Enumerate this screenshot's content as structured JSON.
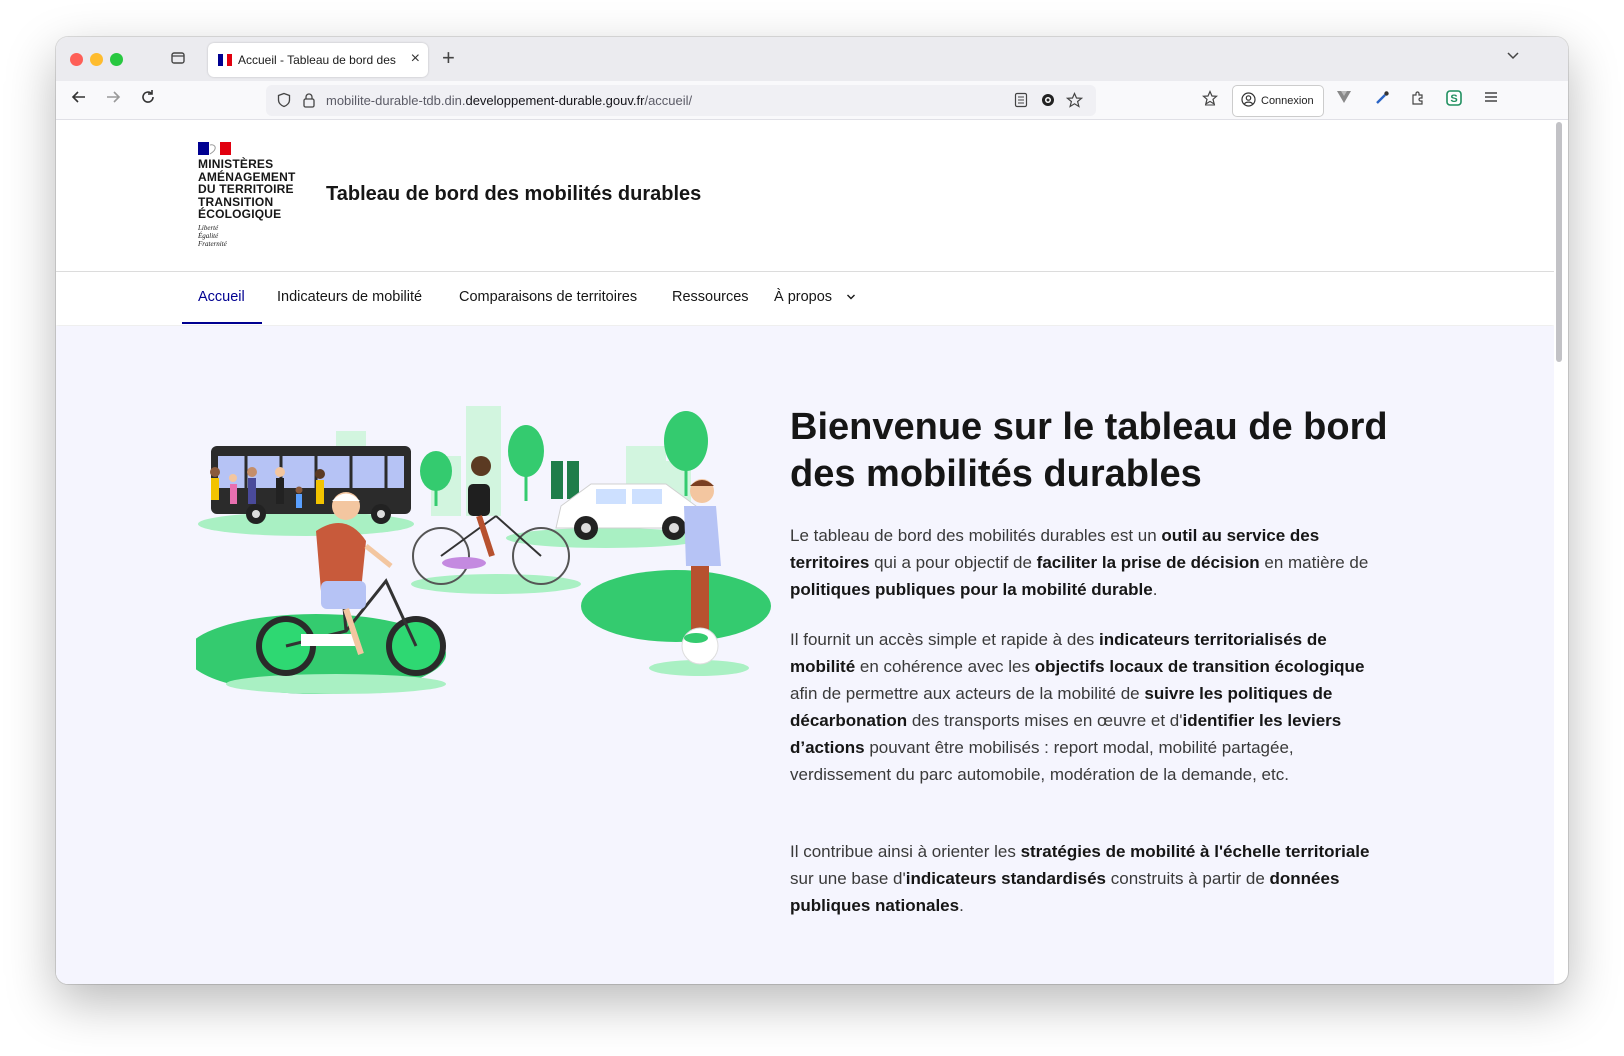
{
  "browser": {
    "tab_title": "Accueil - Tableau de bord des m",
    "url_prefix": "mobilite-durable-tdb.din.",
    "url_domain": "developpement-durable.gouv.fr",
    "url_path": "/accueil/",
    "login_label": "Connexion"
  },
  "header": {
    "ministry_lines": [
      "MINISTÈRES",
      "AMÉNAGEMENT",
      "DU TERRITOIRE",
      "TRANSITION",
      "ÉCOLOGIQUE"
    ],
    "motto_lines": [
      "Liberté",
      "Égalité",
      "Fraternité"
    ],
    "site_title": "Tableau de bord des mobilités durables"
  },
  "nav": {
    "items": [
      "Accueil",
      "Indicateurs de mobilité",
      "Comparaisons de territoires",
      "Ressources",
      "À propos"
    ],
    "active": "Accueil"
  },
  "hero": {
    "title": "Bienvenue sur le tableau de bord des mobilités durables",
    "p1": [
      {
        "t": "Le tableau de bord des mobilités durables est un ",
        "b": false
      },
      {
        "t": "outil au service des territoires",
        "b": true
      },
      {
        "t": " qui a pour objectif de ",
        "b": false
      },
      {
        "t": "faciliter la prise de décision",
        "b": true
      },
      {
        "t": " en matière de ",
        "b": false
      },
      {
        "t": "politiques publiques pour la mobilité durable",
        "b": true
      },
      {
        "t": ".",
        "b": false
      }
    ],
    "p2": [
      {
        "t": "Il fournit un accès simple et rapide à des ",
        "b": false
      },
      {
        "t": "indicateurs territorialisés de mobilité",
        "b": true
      },
      {
        "t": " en cohérence avec les ",
        "b": false
      },
      {
        "t": "objectifs locaux de transition écologique",
        "b": true
      },
      {
        "t": " afin de permettre aux acteurs de la mobilité de ",
        "b": false
      },
      {
        "t": "suivre les politiques de décarbonation",
        "b": true
      },
      {
        "t": " des transports mises en œuvre et d'",
        "b": false
      },
      {
        "t": "identifier les leviers d’actions",
        "b": true
      },
      {
        "t": " pouvant être mobilisés : report modal, mobilité partagée, verdissement du parc automobile, modération de la demande, etc.",
        "b": false
      }
    ],
    "p3": [
      {
        "t": "Il contribue ainsi à orienter les ",
        "b": false
      },
      {
        "t": "stratégies de mobilité à l'échelle territoriale",
        "b": true
      },
      {
        "t": " sur une base d'",
        "b": false
      },
      {
        "t": "indicateurs standardisés",
        "b": true
      },
      {
        "t": " construits à partir de ",
        "b": false
      },
      {
        "t": "données publiques nationales",
        "b": true
      },
      {
        "t": ".",
        "b": false
      }
    ]
  },
  "icons": {
    "back": "back-arrow-icon",
    "forward": "forward-arrow-icon",
    "reload": "reload-icon",
    "shield": "tracking-shield-icon",
    "lock": "lock-icon",
    "reader": "reader-view-icon",
    "extension": "extension-icon",
    "bookmark": "bookmark-star-icon",
    "menu": "hamburger-menu-icon"
  },
  "colors": {
    "accent": "#000091",
    "green": "#34cb6f",
    "hero_bg": "#f5f5fe"
  }
}
